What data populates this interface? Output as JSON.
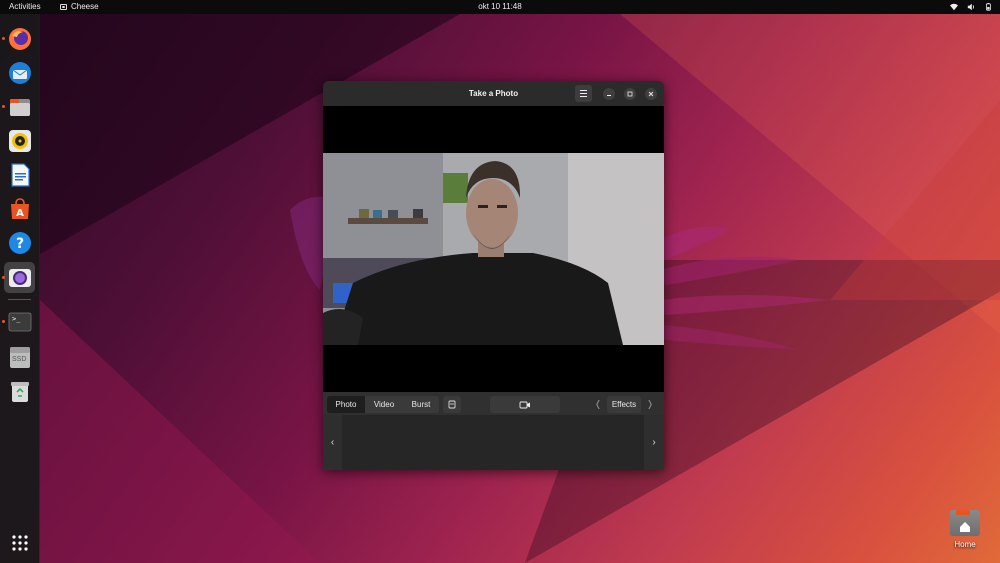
{
  "topbar": {
    "activities_label": "Activities",
    "app_name": "Cheese",
    "clock": "okt 10  11:48"
  },
  "dock": {
    "items": [
      {
        "name": "Firefox",
        "icon": "firefox-icon",
        "running": true
      },
      {
        "name": "Thunderbird",
        "icon": "thunderbird-icon",
        "running": false
      },
      {
        "name": "Files",
        "icon": "files-icon",
        "running": true
      },
      {
        "name": "Rhythmbox",
        "icon": "rhythmbox-icon",
        "running": false
      },
      {
        "name": "LibreOffice Writer",
        "icon": "writer-icon",
        "running": false
      },
      {
        "name": "Ubuntu Software",
        "icon": "software-icon",
        "running": false
      },
      {
        "name": "Help",
        "icon": "help-icon",
        "running": false
      },
      {
        "name": "Cheese",
        "icon": "cheese-icon",
        "running": true,
        "active": true
      },
      {
        "name": "Terminal",
        "icon": "terminal-icon",
        "running": true
      },
      {
        "name": "SSD",
        "icon": "drive-icon",
        "label": "SSD"
      },
      {
        "name": "Trash",
        "icon": "trash-icon"
      }
    ],
    "show_apps_icon": "grid-icon"
  },
  "window": {
    "title": "Take a Photo",
    "modes": [
      "Photo",
      "Video",
      "Burst"
    ],
    "active_mode": "Photo",
    "effects_label": "Effects",
    "prev_glyph": "❬",
    "next_glyph": "❭",
    "thumb_prev_glyph": "‹",
    "thumb_next_glyph": "›"
  },
  "desktop": {
    "home_label": "Home"
  },
  "colors": {
    "accent": "#e95420",
    "panel": "#0b0b0b",
    "window_bg": "#303030"
  }
}
